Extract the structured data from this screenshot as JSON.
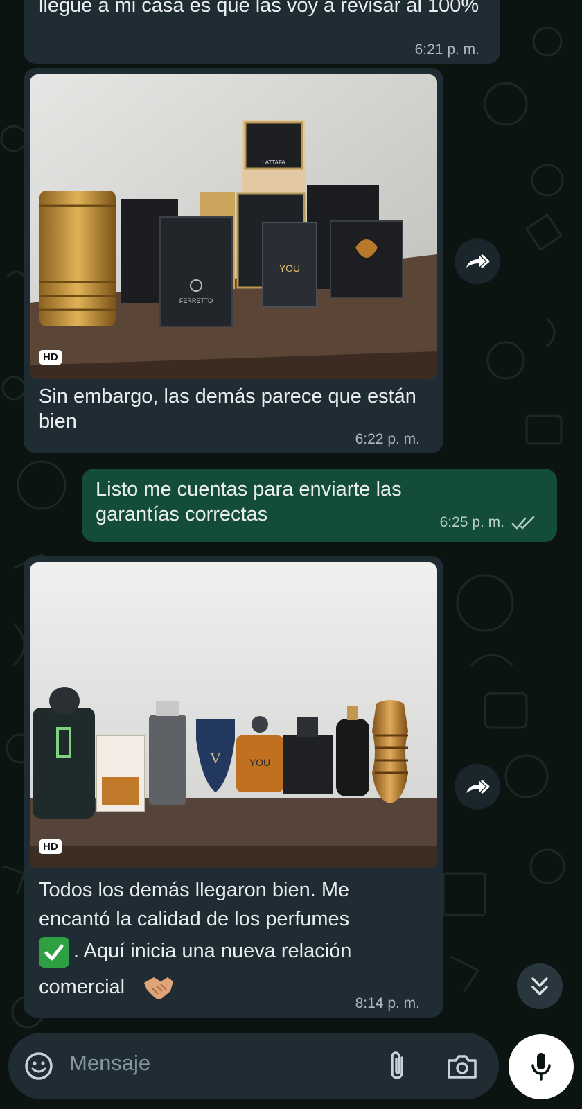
{
  "messages": [
    {
      "direction": "in",
      "text": "llegue a mi casa es que las voy a revisar al 100%",
      "time": "6:21 p. m."
    },
    {
      "direction": "in",
      "type": "image",
      "badge": "HD",
      "image_label": "Photo of boxed perfumes on a wooden table",
      "box_labels": [
        "YOU",
        "LATTAFA",
        "FERRETTO"
      ],
      "caption": "Sin embargo, las demás parece que están bien",
      "time": "6:22 p. m."
    },
    {
      "direction": "out",
      "text": "Listo me cuentas para enviarte las garantías correctas",
      "time": "6:25 p. m.",
      "status": "read"
    },
    {
      "direction": "in",
      "type": "image",
      "badge": "HD",
      "image_label": "Photo of perfume bottles lined up on a wooden table",
      "bottle_labels": [
        "V",
        "YOU"
      ],
      "caption_lines": [
        "Todos los demás llegaron bien. Me",
        "encantó la calidad de los perfumes"
      ],
      "caption_mid": ". Aquí inicia una nueva relación",
      "caption_end": "comercial",
      "time": "8:14 p. m."
    }
  ],
  "composer": {
    "placeholder": "Mensaje"
  },
  "icons": {
    "forward": "forward-icon",
    "scroll_down": "chevron-double-down-icon",
    "emoji": "sticker-icon",
    "attach": "paperclip-icon",
    "camera": "camera-icon",
    "mic": "microphone-icon",
    "read_receipt": "double-check-icon",
    "check_emoji": "white-check-mark-icon",
    "handshake_emoji": "handshake-icon"
  },
  "colors": {
    "background": "#0b1411",
    "incoming_bubble": "#1f2c33",
    "outgoing_bubble": "#134d37",
    "read_check": "#b8cdc4"
  }
}
